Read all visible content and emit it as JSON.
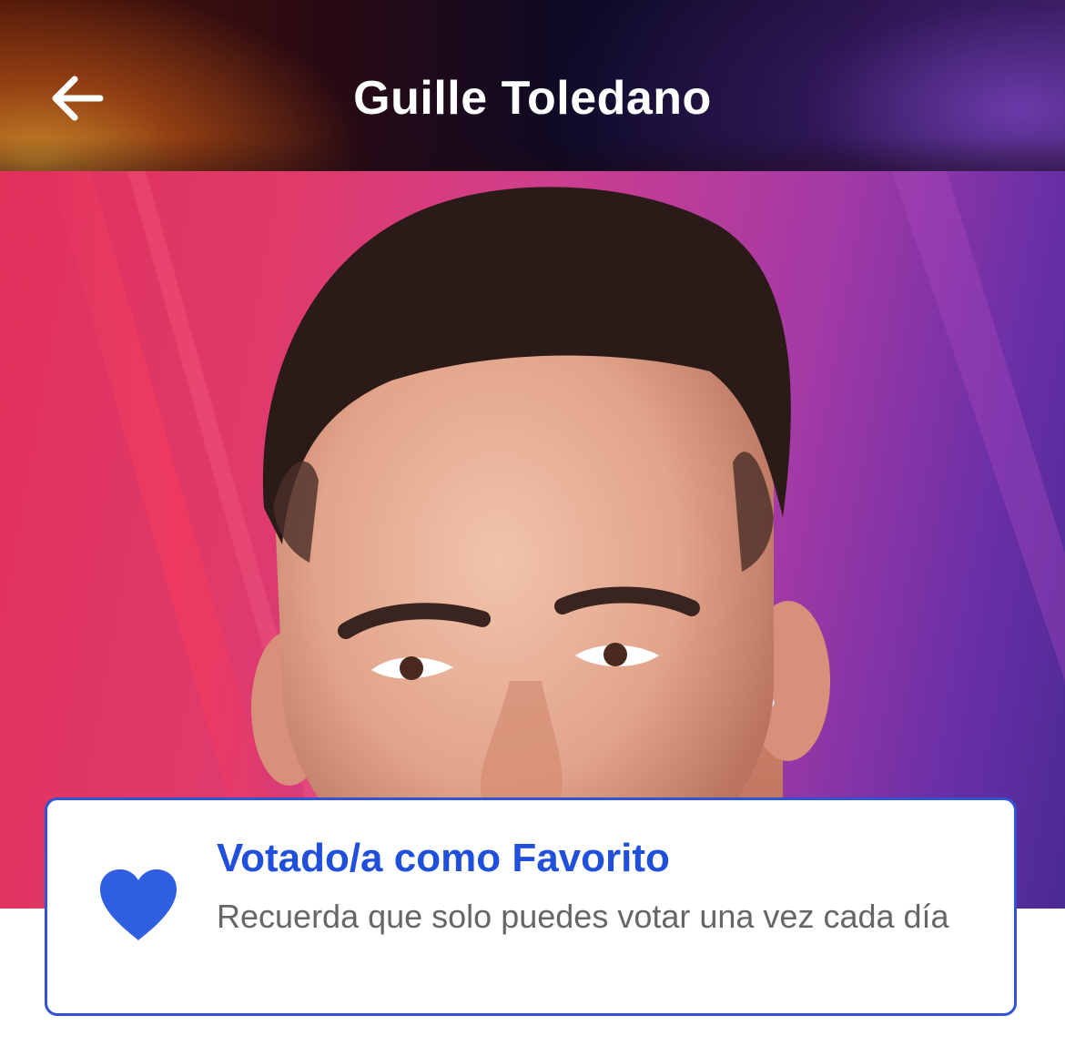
{
  "header": {
    "title": "Guille Toledano",
    "back_icon": "arrow-left-icon"
  },
  "hero": {
    "image": "contestant-portrait"
  },
  "vote_card": {
    "title": "Votado/a como Favorito",
    "subtitle": "Recuerda que solo puedes votar una vez cada día",
    "icon": "heart-icon"
  },
  "colors": {
    "accent": "#1f4fdb",
    "card_border": "#2f55d4",
    "subtitle_text": "#666666"
  }
}
